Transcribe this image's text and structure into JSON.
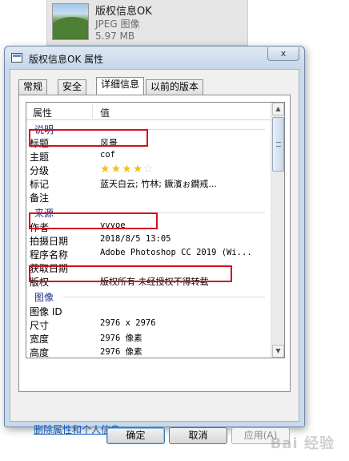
{
  "file": {
    "name": "版权信息OK",
    "type": "JPEG 图像",
    "size": "5.97 MB",
    "thumbnail_icon": "landscape-thumbnail"
  },
  "dialog": {
    "title": "版权信息OK 属性",
    "close_label": "x",
    "tabs": [
      {
        "label": "常规",
        "active": false
      },
      {
        "label": "安全",
        "active": false
      },
      {
        "label": "详细信息",
        "active": true
      },
      {
        "label": "以前的版本",
        "active": false
      }
    ],
    "columns": {
      "property": "属性",
      "value": "值"
    },
    "groups": {
      "description": {
        "label": "说明",
        "rows": [
          {
            "prop": "标题",
            "value": "风景"
          },
          {
            "prop": "主题",
            "value": "cof"
          },
          {
            "prop": "分级",
            "value": "",
            "stars_filled": 4,
            "stars_total": 5
          },
          {
            "prop": "标记",
            "value": "蓝天白云; 竹林; 鐝濱ぉ鐗戒..."
          },
          {
            "prop": "备注",
            "value": ""
          }
        ]
      },
      "source": {
        "label": "来源",
        "rows": [
          {
            "prop": "作者",
            "value": "yvyoe"
          },
          {
            "prop": "拍摄日期",
            "value": "2018/8/5 13:05"
          },
          {
            "prop": "程序名称",
            "value": "Adobe Photoshop CC 2019 (Wi..."
          },
          {
            "prop": "获取日期",
            "value": ""
          },
          {
            "prop": "版权",
            "value": "版权所有 未经授权不得转载"
          }
        ]
      },
      "image": {
        "label": "图像",
        "rows": [
          {
            "prop": "图像 ID",
            "value": ""
          },
          {
            "prop": "尺寸",
            "value": "2976 x 2976"
          },
          {
            "prop": "宽度",
            "value": "2976 像素"
          },
          {
            "prop": "高度",
            "value": "2976 像素"
          }
        ]
      }
    },
    "remove_link": "删除属性和个人信息",
    "buttons": {
      "ok": "确定",
      "cancel": "取消",
      "apply": "应用(A)"
    }
  },
  "highlight_color": "#d6101b",
  "watermark": "Bai 经验"
}
